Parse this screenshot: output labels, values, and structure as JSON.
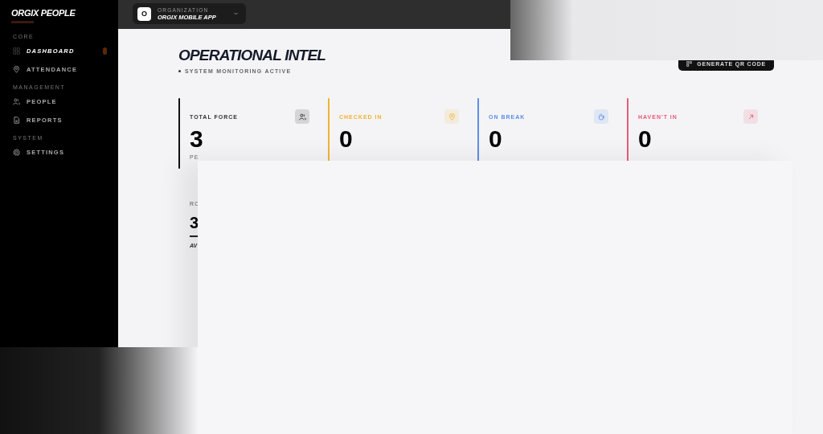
{
  "sidebar": {
    "brand": "ORGIX PEOPLE",
    "sections": [
      {
        "title": "CORE",
        "items": [
          {
            "label": "DASHBOARD",
            "kind": "grid",
            "selected": true,
            "badge": true
          },
          {
            "label": "ATTENDANCE",
            "kind": "pin",
            "selected": false,
            "badge": false
          }
        ]
      },
      {
        "title": "MANAGEMENT",
        "items": [
          {
            "label": "PEOPLE",
            "kind": "people",
            "selected": false,
            "badge": false
          },
          {
            "label": "REPORTS",
            "kind": "doc",
            "selected": false,
            "badge": false
          }
        ]
      },
      {
        "title": "SYSTEM",
        "items": [
          {
            "label": "SETTINGS",
            "kind": "gear",
            "selected": false,
            "badge": false
          }
        ]
      }
    ]
  },
  "org_switcher": {
    "logo": "O",
    "caption": "ORGANIZATION",
    "name": "ORGIX MOBILE APP"
  },
  "header": {
    "title": "OPERATIONAL INTEL",
    "status": "SYSTEM MONITORING ACTIVE",
    "action": "GENERATE QR CODE"
  },
  "stats": [
    {
      "label": "TOTAL FORCE",
      "value": "3",
      "sub": "PE",
      "kind": "people",
      "color": "#111111"
    },
    {
      "label": "CHECKED IN",
      "value": "0",
      "kind": "pin",
      "color": "#f2b233"
    },
    {
      "label": "ON BREAK",
      "value": "0",
      "kind": "cup",
      "color": "#5b8fe8"
    },
    {
      "label": "HAVEN'T IN",
      "value": "0",
      "kind": "arrow",
      "color": "#ea5a78"
    }
  ],
  "summary": {
    "label": "RO",
    "value": "3",
    "caption": "AV"
  }
}
